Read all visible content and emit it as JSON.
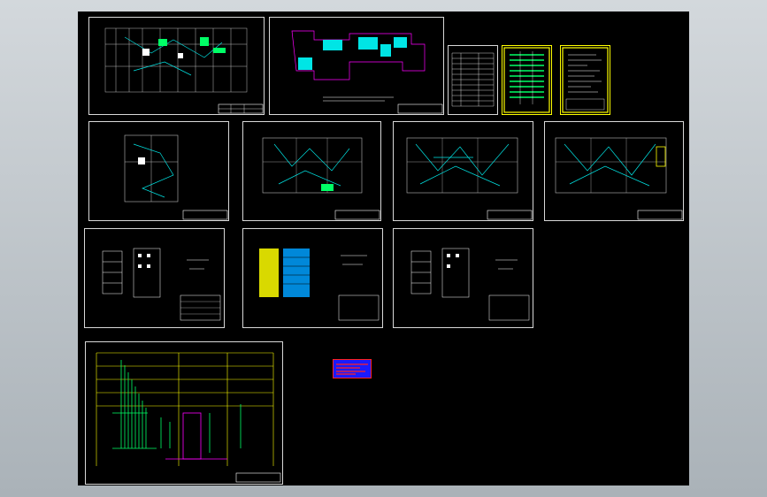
{
  "window": {
    "title": "",
    "view": "model-space-overview"
  },
  "canvas": {
    "background": "#000000",
    "frame_color": "#d8d8d8",
    "accent_colors": {
      "wiring": "#00e5e5",
      "fixtures": "#ffffff",
      "highlight": "#ffff00",
      "panels": "#00ff66",
      "markers": "#ff00ff",
      "table_bg": "#1a1aff",
      "table_text": "#ff2020"
    }
  },
  "sheets": [
    {
      "id": "plan-floor-1",
      "kind": "floor-plan",
      "text": ""
    },
    {
      "id": "site-plan",
      "kind": "site-plan",
      "text": ""
    },
    {
      "id": "legend-table",
      "kind": "legend",
      "text": ""
    },
    {
      "id": "equipment-list-yellow",
      "kind": "list",
      "text": ""
    },
    {
      "id": "notes-sheet",
      "kind": "notes",
      "text": ""
    },
    {
      "id": "small-plan",
      "kind": "floor-plan",
      "text": ""
    },
    {
      "id": "lighting-plan-1",
      "kind": "lighting-plan",
      "text": ""
    },
    {
      "id": "lighting-plan-2",
      "kind": "lighting-plan",
      "text": ""
    },
    {
      "id": "lighting-plan-3",
      "kind": "lighting-plan",
      "text": ""
    },
    {
      "id": "riser-diagram-1",
      "kind": "riser",
      "text": ""
    },
    {
      "id": "riser-diagram-2",
      "kind": "riser",
      "text": ""
    },
    {
      "id": "riser-diagram-3",
      "kind": "riser",
      "text": ""
    },
    {
      "id": "system-diagram",
      "kind": "system",
      "text": ""
    },
    {
      "id": "red-table",
      "kind": "table",
      "text": ""
    }
  ]
}
